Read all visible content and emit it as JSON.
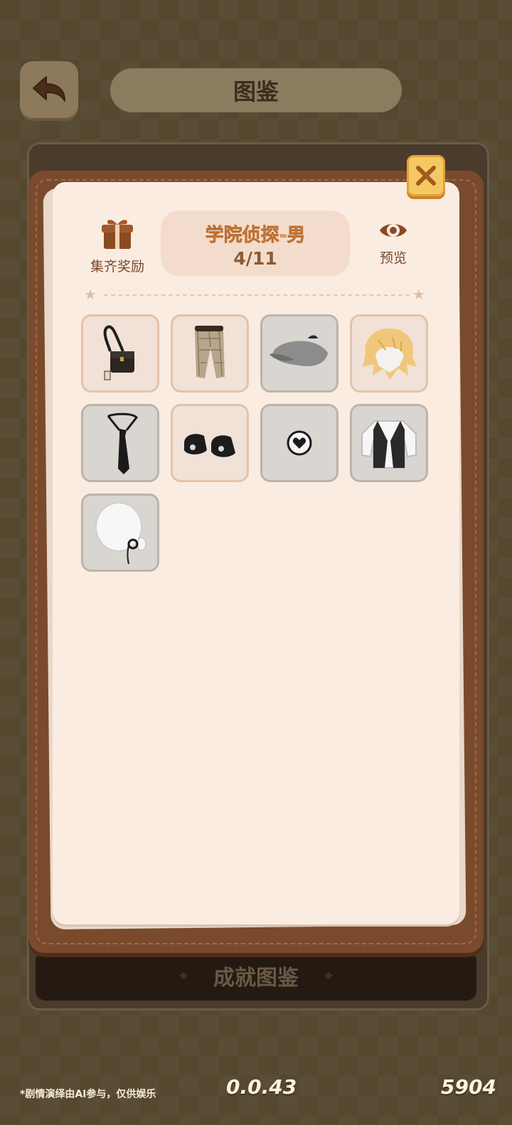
{
  "header": {
    "title": "图鉴"
  },
  "panel": {
    "reward_label": "集齐奖励",
    "set_name": "学院侦探-男",
    "progress": "4/11",
    "preview_label": "预览"
  },
  "items": [
    {
      "name": "satchel",
      "owned": true
    },
    {
      "name": "plaid-pants",
      "owned": true
    },
    {
      "name": "newsboy-cap",
      "owned": false
    },
    {
      "name": "blonde-hair",
      "owned": true
    },
    {
      "name": "tie",
      "owned": false
    },
    {
      "name": "shoes",
      "owned": true
    },
    {
      "name": "heart-accessory",
      "owned": false
    },
    {
      "name": "vest-shirt",
      "owned": false
    },
    {
      "name": "monocle-face",
      "owned": false
    }
  ],
  "underlay": {
    "button_label": "成就图鉴"
  },
  "footer": {
    "disclaimer": "*剧情演绎由AI参与，仅供娱乐",
    "version": "0.0.43",
    "uid": "5904"
  },
  "colors": {
    "accent": "#e29a55",
    "close": "#f4c964",
    "page": "#fbece2"
  }
}
